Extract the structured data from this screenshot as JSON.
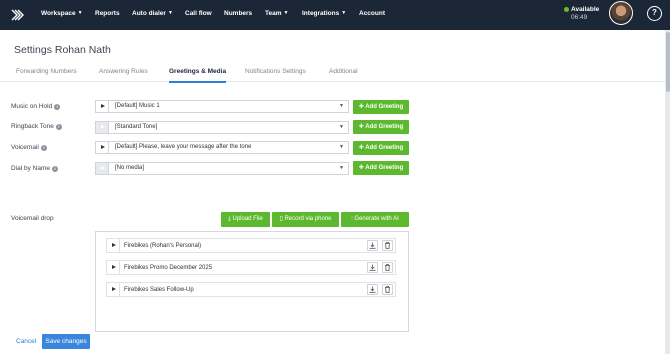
{
  "nav": {
    "items": [
      {
        "label": "Workspace",
        "has_caret": true
      },
      {
        "label": "Reports",
        "has_caret": false
      },
      {
        "label": "Auto dialer",
        "has_caret": true
      },
      {
        "label": "Call flow",
        "has_caret": false
      },
      {
        "label": "Numbers",
        "has_caret": false
      },
      {
        "label": "Team",
        "has_caret": true
      },
      {
        "label": "Integrations",
        "has_caret": true
      },
      {
        "label": "Account",
        "has_caret": false
      }
    ],
    "status_label": "Available",
    "status_time": "06:49",
    "status_color": "#64c21f",
    "help_label": "?"
  },
  "page": {
    "title": "Settings Rohan Nath",
    "tabs": [
      {
        "label": "Forwarding Numbers",
        "active": false
      },
      {
        "label": "Answering Rules",
        "active": false
      },
      {
        "label": "Greetings & Media",
        "active": true
      },
      {
        "label": "Notifications Settings",
        "active": false
      },
      {
        "label": "Additional",
        "active": false
      }
    ]
  },
  "greetings": {
    "add_label": "Add Greeting",
    "rows": [
      {
        "label": "Music on Hold",
        "value": "[Default] Music 1",
        "play_enabled": true
      },
      {
        "label": "Ringback Tone",
        "value": "[Standard Tone]",
        "play_enabled": false
      },
      {
        "label": "Voicemail",
        "value": "[Default] Please, leave your message after the tone",
        "play_enabled": true
      },
      {
        "label": "Dial by Name",
        "value": "[No media]",
        "play_enabled": false
      }
    ]
  },
  "voicemail_drop": {
    "label": "Voicemail drop",
    "upload_label": "Upload File",
    "record_label": "Record via phone",
    "generate_label": "Generate with AI",
    "items": [
      {
        "name": "Firebikes (Rohan's Personal)"
      },
      {
        "name": "Firebikes Promo December 2025"
      },
      {
        "name": "Firebikes Sales Follow-Up"
      }
    ]
  },
  "footer": {
    "cancel_label": "Cancel",
    "save_label": "Save changes"
  },
  "colors": {
    "nav_bg": "#1b2637",
    "green": "#5cb82f",
    "blue": "#3b86dd",
    "tab_active_underline": "#2d7fd3"
  }
}
